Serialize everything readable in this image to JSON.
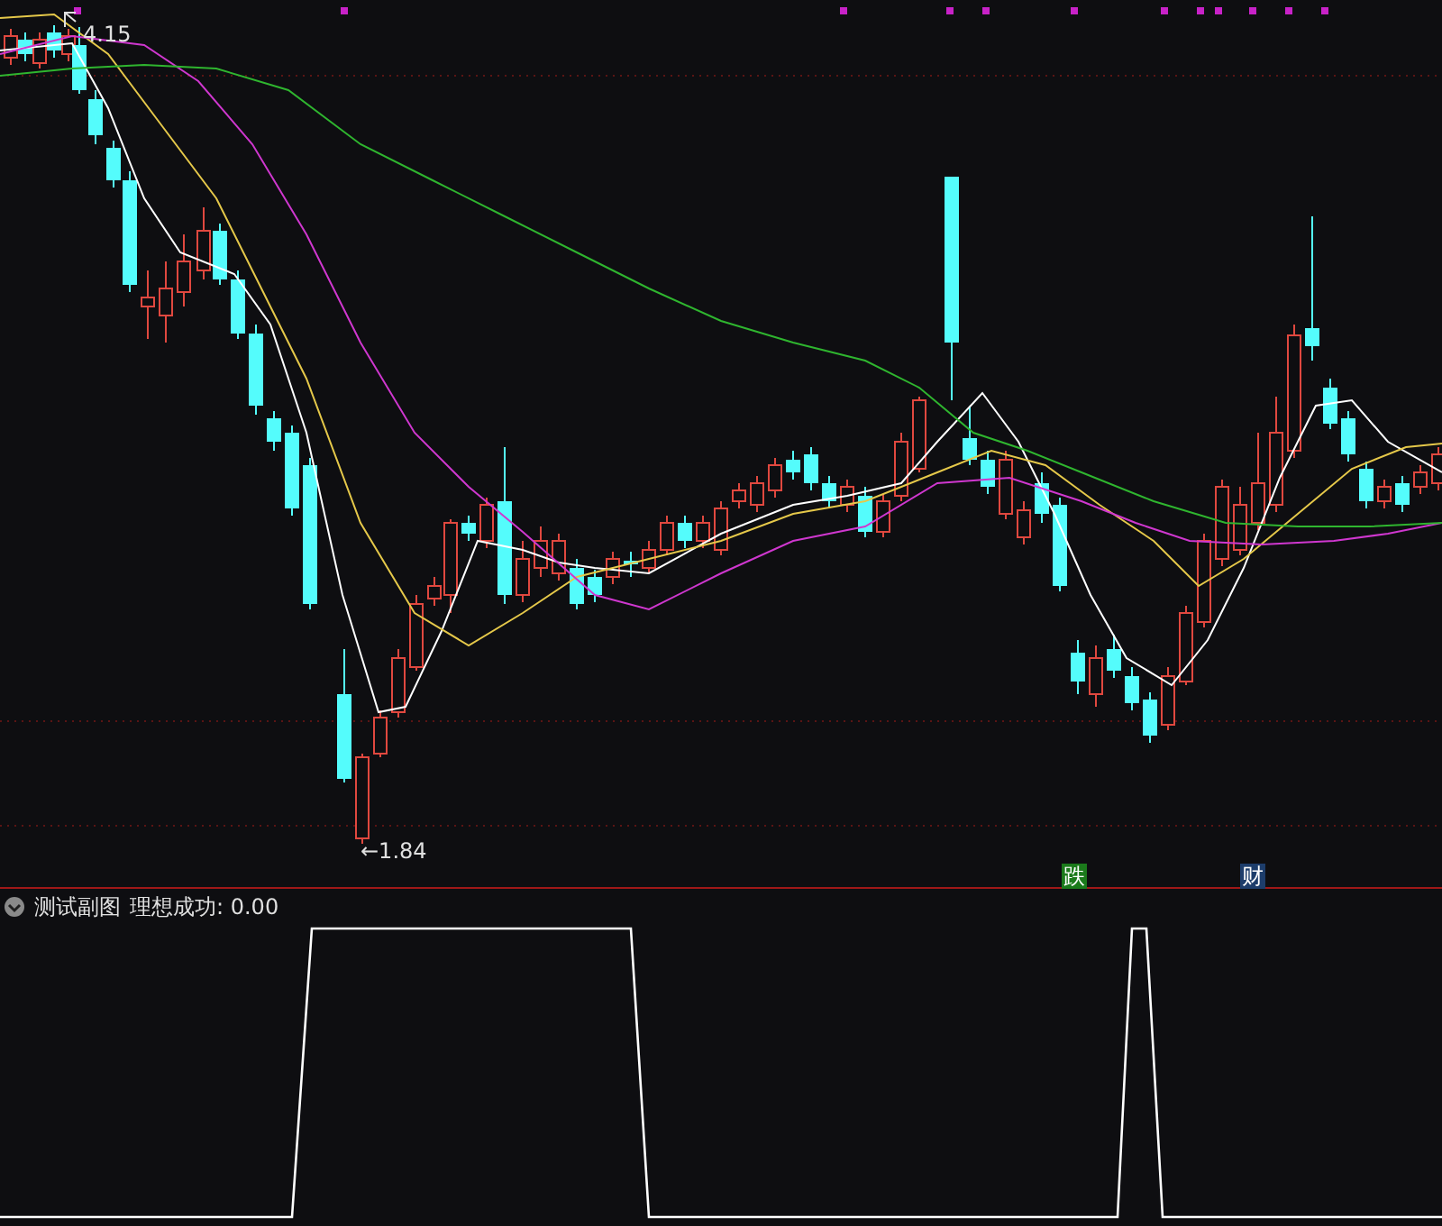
{
  "main_chart": {
    "high_label": "4.15",
    "low_label": "←1.84",
    "signals": [
      {
        "text": "跌",
        "color": "#1b7a1b"
      },
      {
        "text": "财",
        "color": "#1d3d6b"
      }
    ]
  },
  "sub_chart": {
    "title": "测试副图",
    "indicator": "理想成功: 0.00"
  }
}
